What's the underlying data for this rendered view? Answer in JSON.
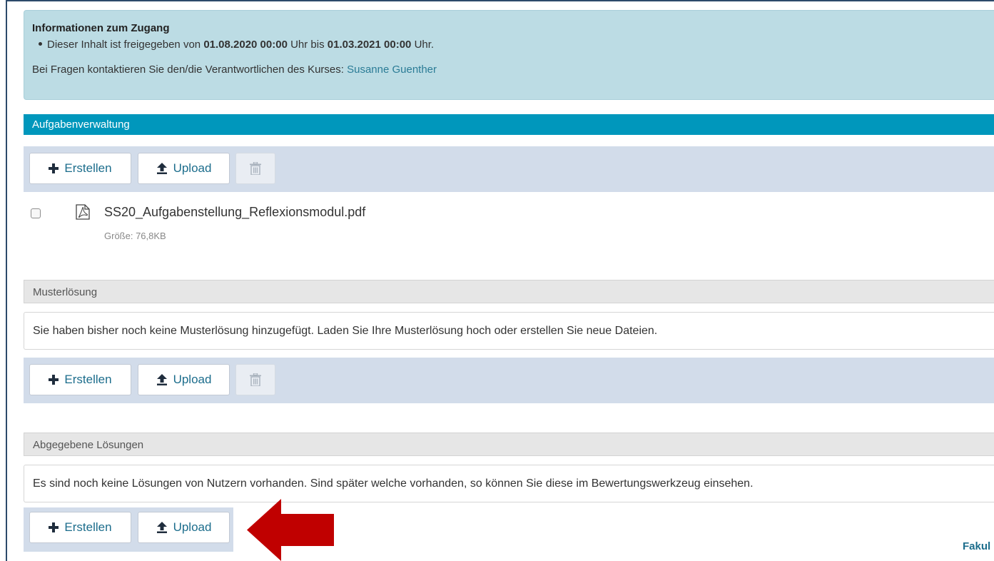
{
  "access_info": {
    "title": "Informationen zum Zugang",
    "release_prefix": "Dieser Inhalt ist freigegeben von",
    "release_from": "01.08.2020 00:00",
    "release_mid": "Uhr bis",
    "release_to": "01.03.2021 00:00",
    "release_suffix": "Uhr.",
    "contact_text": "Bei Fragen kontaktieren Sie den/die Verantwortlichen des Kurses:",
    "contact_name": "Susanne Guenther"
  },
  "task_management": {
    "header": "Aufgabenverwaltung",
    "create_label": "Erstellen",
    "upload_label": "Upload",
    "file": {
      "name": "SS20_Aufgabenstellung_Reflexionsmodul.pdf",
      "size": "Größe: 76,8KB"
    }
  },
  "sample_solution": {
    "header": "Musterlösung",
    "empty_message": "Sie haben bisher noch keine Musterlösung hinzugefügt. Laden Sie Ihre Musterlösung hoch oder erstellen Sie neue Dateien.",
    "create_label": "Erstellen",
    "upload_label": "Upload"
  },
  "submitted_solutions": {
    "header": "Abgegebene Lösungen",
    "empty_message": "Es sind noch keine Lösungen von Nutzern vorhanden. Sind später welche vorhanden, so können Sie diese im Bewertungswerkzeug einsehen.",
    "create_label": "Erstellen",
    "upload_label": "Upload"
  },
  "footer_fragment": "Fakul",
  "colors": {
    "accent": "#0097bc",
    "link": "#1c6d8c",
    "annotation_arrow": "#c00000"
  },
  "icons": [
    "plus-icon",
    "upload-icon",
    "trash-icon",
    "pdf-file-icon",
    "red-arrow-icon"
  ]
}
